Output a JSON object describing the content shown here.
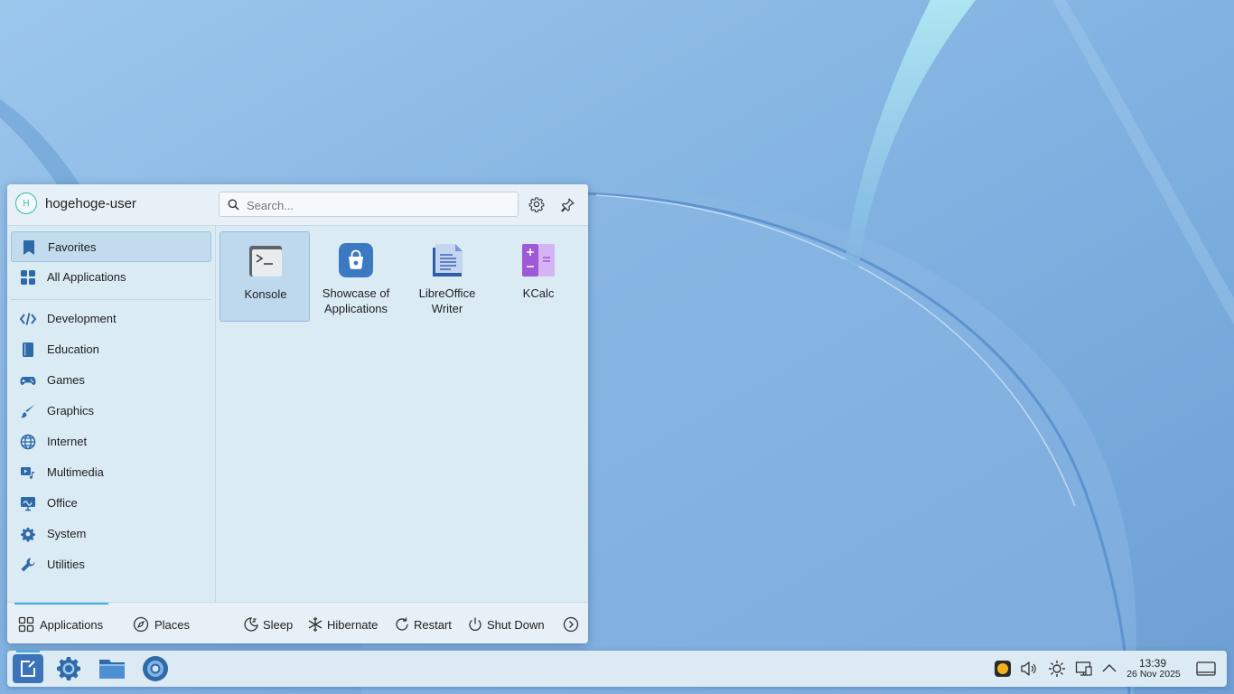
{
  "launcher": {
    "user": {
      "initial": "H",
      "name": "hogehoge-user"
    },
    "search": {
      "placeholder": "Search..."
    },
    "header_icons": [
      "gear-icon",
      "pin-icon"
    ],
    "sidebar": {
      "favorites": "Favorites",
      "all_applications": "All Applications",
      "categories": [
        {
          "label": "Development",
          "icon": "code-icon"
        },
        {
          "label": "Education",
          "icon": "book-icon"
        },
        {
          "label": "Games",
          "icon": "gamepad-icon"
        },
        {
          "label": "Graphics",
          "icon": "brush-icon"
        },
        {
          "label": "Internet",
          "icon": "globe-icon"
        },
        {
          "label": "Multimedia",
          "icon": "multimedia-icon"
        },
        {
          "label": "Office",
          "icon": "presentation-icon"
        },
        {
          "label": "System",
          "icon": "gear-icon"
        },
        {
          "label": "Utilities",
          "icon": "wrench-icon"
        }
      ]
    },
    "apps": [
      {
        "label": "Konsole",
        "icon": "terminal-icon"
      },
      {
        "label": "Showcase of Applications",
        "icon": "store-icon"
      },
      {
        "label": "LibreOffice Writer",
        "icon": "writer-icon"
      },
      {
        "label": "KCalc",
        "icon": "calculator-icon"
      }
    ],
    "footer": {
      "tabs": {
        "applications": "Applications",
        "places": "Places"
      },
      "power": {
        "sleep": "Sleep",
        "hibernate": "Hibernate",
        "restart": "Restart",
        "shutdown": "Shut Down"
      }
    }
  },
  "taskbar": {
    "apps": [
      "start-menu-icon",
      "system-settings-icon",
      "file-manager-icon",
      "browser-icon"
    ],
    "tray": [
      "weather-icon",
      "volume-icon",
      "brightness-icon",
      "display-icon",
      "expand-icon"
    ],
    "clock": {
      "time": "13:39",
      "date": "26 Nov 2025"
    }
  },
  "colors": {
    "accent": "#3daee9",
    "menu_bg": "#dbebf4",
    "selection": "#c2dcee",
    "icon_blue": "#2f6aa8"
  }
}
